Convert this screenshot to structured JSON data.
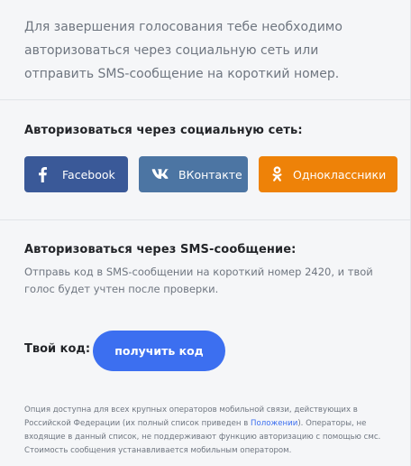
{
  "intro": {
    "text": "Для завершения голосования тебе необходимо авторизоваться через социальную сеть или отправить SMS-сообщение на короткий номер."
  },
  "social": {
    "title": "Авторизоваться через социальную сеть:",
    "buttons": [
      {
        "label": "Facebook",
        "icon": "facebook-icon",
        "color": "#3a5998"
      },
      {
        "label": "ВКонтакте",
        "icon": "vk-icon",
        "color": "#4c75a3"
      },
      {
        "label": "Одноклассники",
        "icon": "odnoklassniki-icon",
        "color": "#ee8208"
      }
    ]
  },
  "sms": {
    "title": "Авторизоваться через SMS-сообщение:",
    "text": "Отправь код в SMS-сообщении на короткий номер 2420, и твой голос будет учтен после проверки.",
    "code_label": "Твой код:",
    "get_code_label": "получить код",
    "get_code_color": "#3c6ff0"
  },
  "footnote": {
    "before_link": "Опция доступна для всех крупных операторов мобильной связи, действующих в Российской Федерации (их полный список приведен в ",
    "link": "Положении",
    "after_link": "). Операторы, не входящие в данный список, не поддерживают функцию авторизацию с помощью смс. Стоимость сообщения устанавливается мобильным оператором."
  }
}
